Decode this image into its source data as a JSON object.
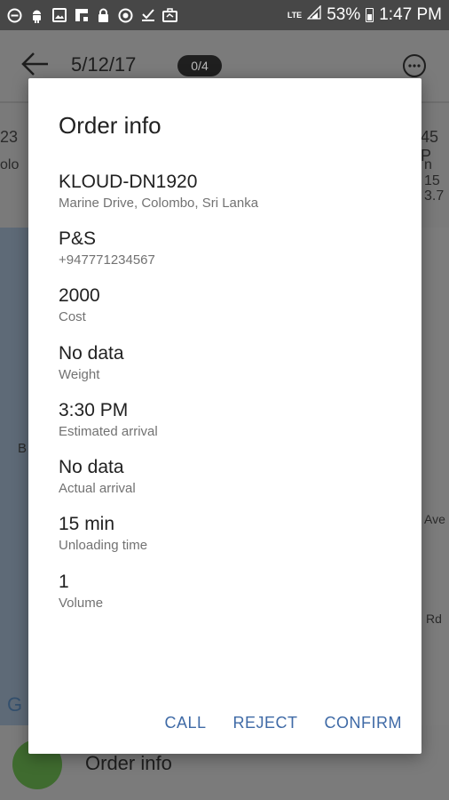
{
  "status_bar": {
    "icons": [
      "minus-circle-icon",
      "android-icon",
      "image-icon",
      "flipboard-icon",
      "lock-icon",
      "target-icon",
      "check-icon",
      "briefcase-icon"
    ],
    "network": "LTE",
    "battery": "53%",
    "time": "1:47 PM"
  },
  "app": {
    "date": "5/12/17",
    "badge": "0/4",
    "card_left_1": "23",
    "card_left_2": "olo",
    "card_right_1": "45 P",
    "card_right_2": "n 15",
    "card_right_3": "3.7",
    "map_letter_b": "B",
    "map_letter_g": "G",
    "map_ave": "Ave",
    "map_rd": "Rd",
    "bottom_title": "Order info"
  },
  "dialog": {
    "title": "Order info",
    "items": [
      {
        "value": "KLOUD-DN1920",
        "label": "Marine Drive, Colombo, Sri Lanka"
      },
      {
        "value": "P&S",
        "label": "+947771234567"
      },
      {
        "value": "2000",
        "label": "Cost"
      },
      {
        "value": "No data",
        "label": "Weight"
      },
      {
        "value": "3:30 PM",
        "label": "Estimated arrival"
      },
      {
        "value": "No data",
        "label": "Actual arrival"
      },
      {
        "value": "15 min",
        "label": "Unloading time"
      },
      {
        "value": "1",
        "label": "Volume"
      }
    ],
    "actions": {
      "call": "CALL",
      "reject": "REJECT",
      "confirm": "CONFIRM"
    }
  },
  "colors": {
    "accent": "#3f6aa6",
    "fab": "#3f6b2f",
    "status_bar": "#474747"
  }
}
